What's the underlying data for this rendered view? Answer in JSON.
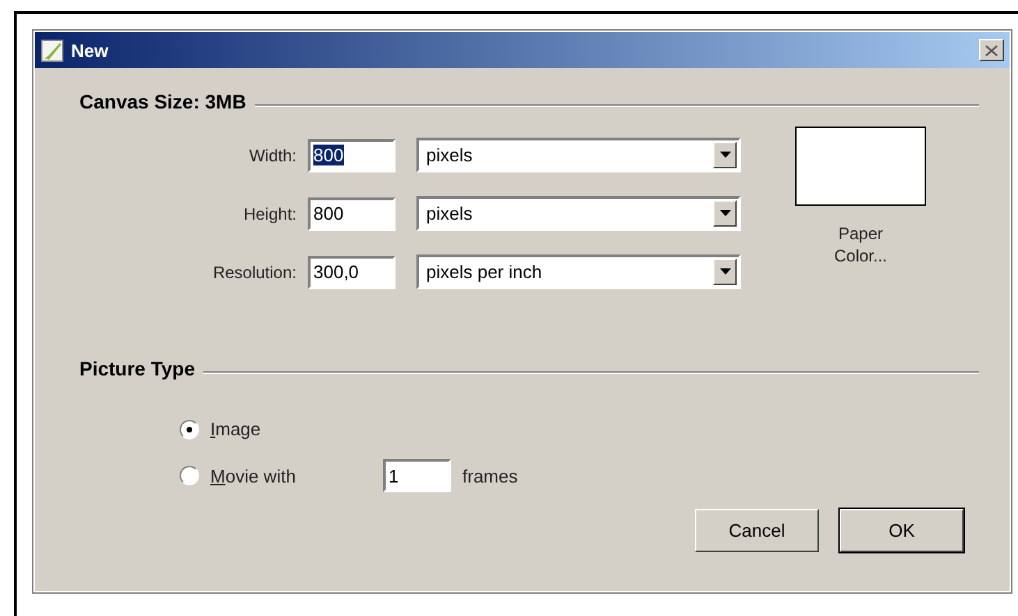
{
  "window": {
    "title": "New"
  },
  "canvas_size": {
    "heading": "Canvas Size: 3MB",
    "rows": [
      {
        "label": "Width:",
        "value": "800",
        "highlighted": true,
        "unit": "pixels"
      },
      {
        "label": "Height:",
        "value": "800",
        "highlighted": false,
        "unit": "pixels"
      },
      {
        "label": "Resolution:",
        "value": "300,0",
        "highlighted": false,
        "unit": "pixels per inch"
      }
    ],
    "paper_color": {
      "label": "Paper Color...",
      "color": "#ffffff"
    }
  },
  "picture_type": {
    "heading": "Picture Type",
    "options": [
      {
        "label": "Image",
        "selected": true
      },
      {
        "label": "Movie with",
        "selected": false,
        "value": "1",
        "suffix": "frames"
      }
    ]
  },
  "buttons": [
    "Cancel",
    "OK"
  ]
}
